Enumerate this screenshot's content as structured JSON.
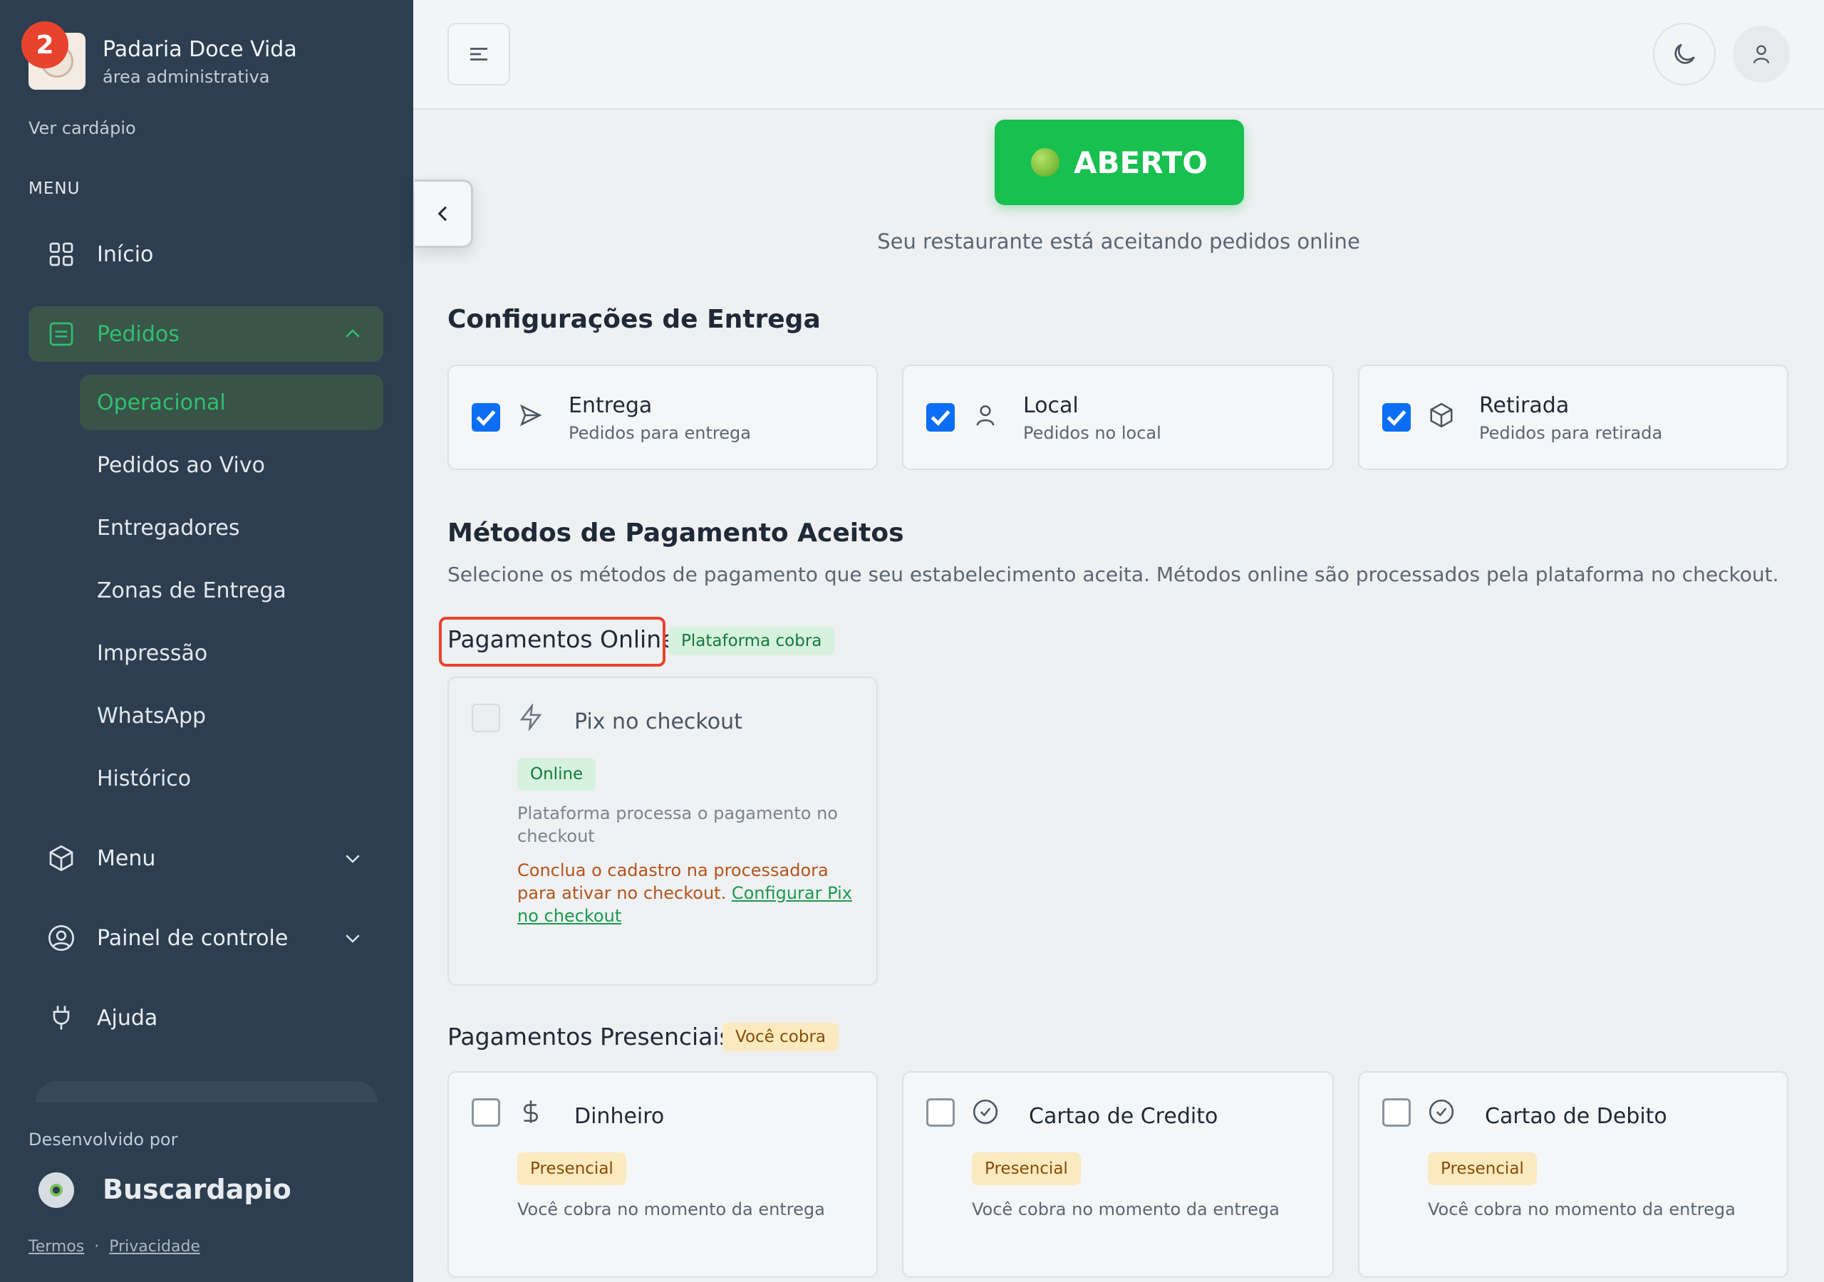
{
  "sidebar": {
    "badge_count": "2",
    "brand_name": "Padaria Doce Vida",
    "brand_sub": "área administrativa",
    "view_menu_link": "Ver cardápio",
    "menu_label": "MENU",
    "items": [
      {
        "label": "Início",
        "icon": "grid-icon"
      },
      {
        "label": "Pedidos",
        "icon": "orders-icon"
      },
      {
        "label": "Menu",
        "icon": "box-icon"
      },
      {
        "label": "Painel de controle",
        "icon": "user-circle-icon"
      },
      {
        "label": "Ajuda",
        "icon": "plug-icon"
      }
    ],
    "sub_items": [
      "Operacional",
      "Pedidos ao Vivo",
      "Entregadores",
      "Zonas de Entrega",
      "Impressão",
      "WhatsApp",
      "Histórico"
    ],
    "footer": {
      "developed_by": "Desenvolvido por",
      "company": "Buscardapio",
      "terms": "Termos",
      "separator": "·",
      "privacy": "Privacidade"
    }
  },
  "status": {
    "button_label": "ABERTO",
    "description": "Seu restaurante está aceitando pedidos online"
  },
  "delivery": {
    "title": "Configurações de Entrega",
    "options": [
      {
        "title": "Entrega",
        "sub": "Pedidos para entrega",
        "checked": true,
        "icon": "send-icon"
      },
      {
        "title": "Local",
        "sub": "Pedidos no local",
        "checked": true,
        "icon": "user-icon"
      },
      {
        "title": "Retirada",
        "sub": "Pedidos para retirada",
        "checked": true,
        "icon": "package-icon"
      }
    ]
  },
  "payments": {
    "title": "Métodos de Pagamento Aceitos",
    "description": "Selecione os métodos de pagamento que seu estabelecimento aceita. Métodos online são processados pela plataforma no checkout.",
    "online": {
      "heading": "Pagamentos Online",
      "badge": "Plataforma cobra",
      "card": {
        "title": "Pix no checkout",
        "tag": "Online",
        "note": "Plataforma processa o pagamento no checkout",
        "warning_line1": "Conclua o cadastro na processadora",
        "warning_line2": "para ativar no checkout.",
        "link_part1": "Configurar Pix",
        "link_part2": "no checkout"
      }
    },
    "in_person": {
      "heading": "Pagamentos Presenciais",
      "badge": "Você cobra",
      "cards": [
        {
          "title": "Dinheiro",
          "tag": "Presencial",
          "note": "Você cobra no momento da entrega",
          "icon": "dollar-icon"
        },
        {
          "title": "Cartao de Credito",
          "tag": "Presencial",
          "note": "Você cobra no momento da entrega",
          "icon": "check-circle-icon"
        },
        {
          "title": "Cartao de Debito",
          "tag": "Presencial",
          "note": "Você cobra no momento da entrega",
          "icon": "check-circle-icon"
        }
      ]
    }
  },
  "colors": {
    "sidebar_bg": "#2c3e50",
    "accent_green": "#18c050",
    "active_text": "#2fbf71",
    "checkbox_blue": "#0b6ef5",
    "highlight_red": "#e8432d"
  }
}
